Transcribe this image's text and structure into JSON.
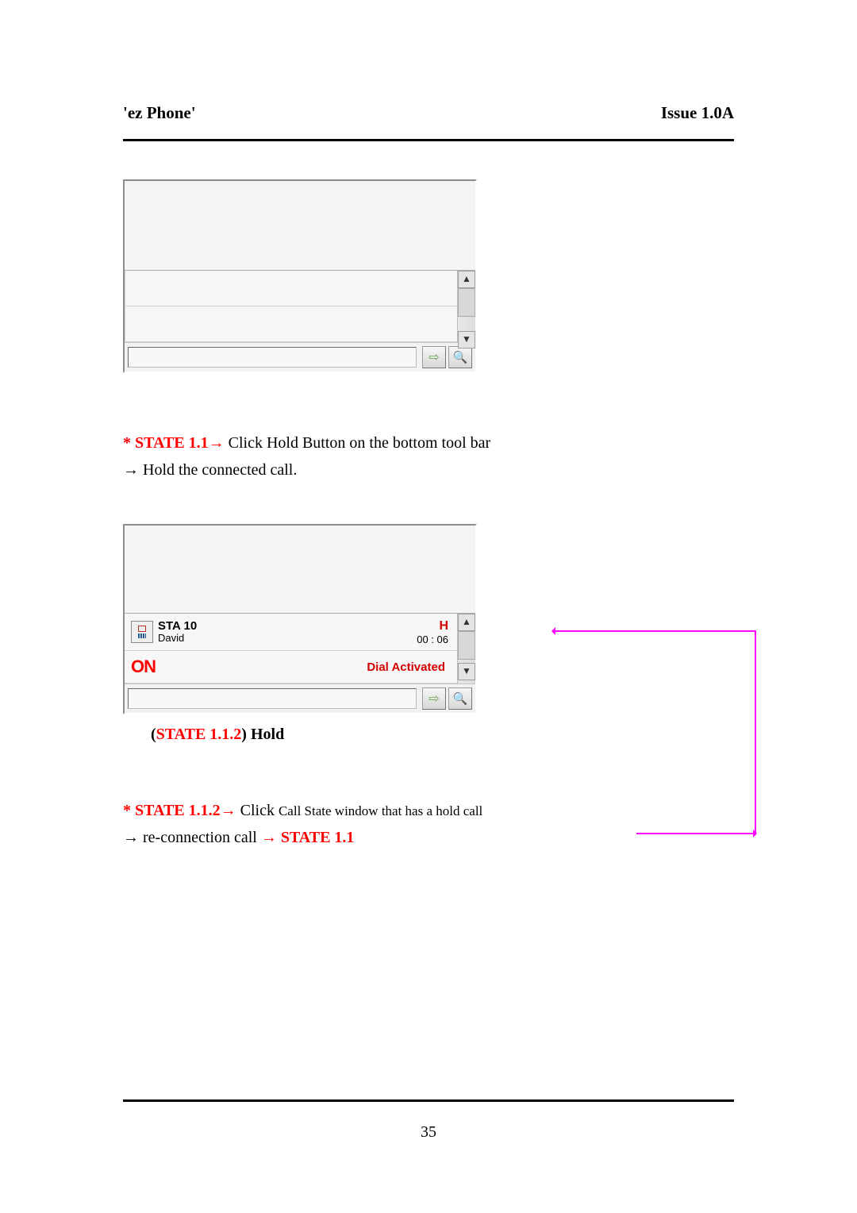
{
  "header": {
    "left": "'ez Phone'",
    "right": "Issue 1.0A"
  },
  "state1_1": {
    "label": "* STATE 1.1",
    "arrow": "→",
    "text_after": " Click Hold Button on the bottom tool bar",
    "line2_prefix": "→",
    "line2_text": " Hold the connected call."
  },
  "panel2": {
    "sta_line": "STA  10",
    "name": "David",
    "hold_glyph": "H",
    "timer": "00 : 06",
    "on": "ON",
    "dial": "Dial Activated"
  },
  "caption": {
    "paren_open": "(",
    "state": "STATE 1.1.2",
    "paren_close_text": ") Hold"
  },
  "state1_1_2": {
    "label": "* STATE 1.1.2",
    "arrow": "→",
    "text_after_small_prefix": " Click ",
    "text_after_small": "Call State window that has a hold call",
    "line2_prefix": "→",
    "line2_text1": " re-connection call ",
    "line2_arrow": "→",
    "line2_state": " STATE 1.1"
  },
  "page_number": "35"
}
